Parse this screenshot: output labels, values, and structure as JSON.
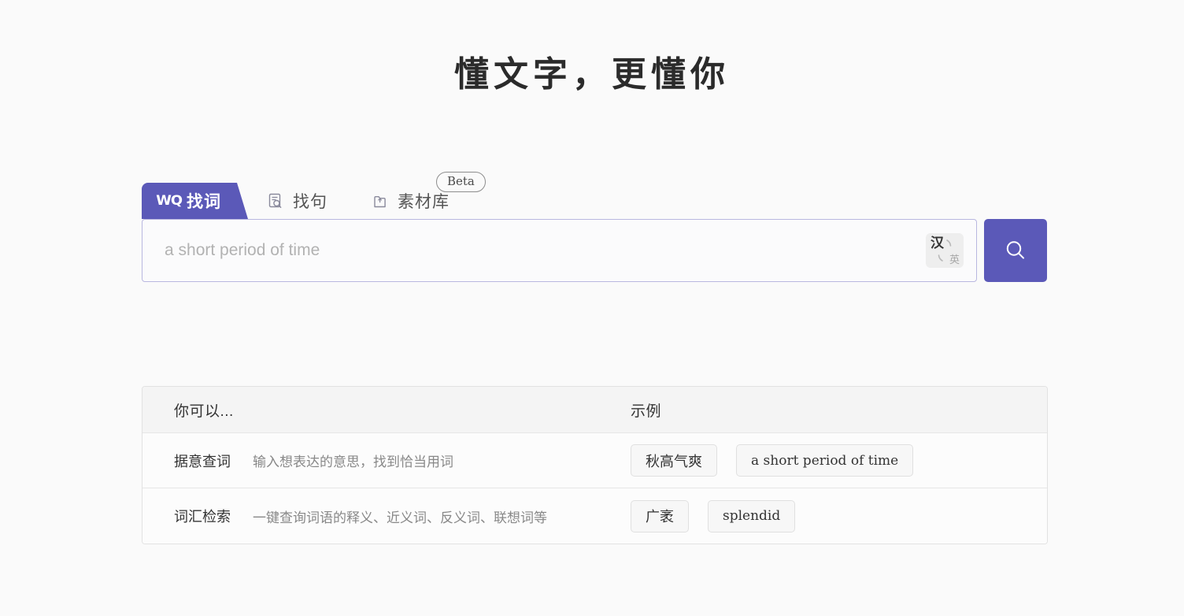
{
  "page": {
    "title": "懂文字，更懂你",
    "background_color": "#fafafa",
    "accent_color": "#5b59b8"
  },
  "tabs": [
    {
      "label": "找词",
      "icon": "wq-logo-icon",
      "active": true,
      "badge": null
    },
    {
      "label": "找句",
      "icon": "document-search-icon",
      "active": false,
      "badge": null
    },
    {
      "label": "素材库",
      "icon": "material-library-icon",
      "active": false,
      "badge": "Beta"
    }
  ],
  "badge": {
    "beta_label": "Beta"
  },
  "search": {
    "value": "",
    "placeholder": "a short period of time",
    "lang_toggle": {
      "primary": "汉",
      "secondary": "英",
      "icon": "language-swap-icon"
    },
    "button_icon": "search-icon"
  },
  "info_table": {
    "headers": {
      "col_a": "你可以...",
      "col_b": "示例"
    },
    "rows": [
      {
        "title": "据意查词",
        "desc": "输入想表达的意思，找到恰当用词",
        "examples": [
          {
            "text": "秋高气爽",
            "latin": false
          },
          {
            "text": "a short period of time",
            "latin": true
          }
        ]
      },
      {
        "title": "词汇检索",
        "desc": "一键查询词语的释义、近义词、反义词、联想词等",
        "examples": [
          {
            "text": "广袤",
            "latin": false
          },
          {
            "text": "splendid",
            "latin": true
          }
        ]
      }
    ]
  }
}
